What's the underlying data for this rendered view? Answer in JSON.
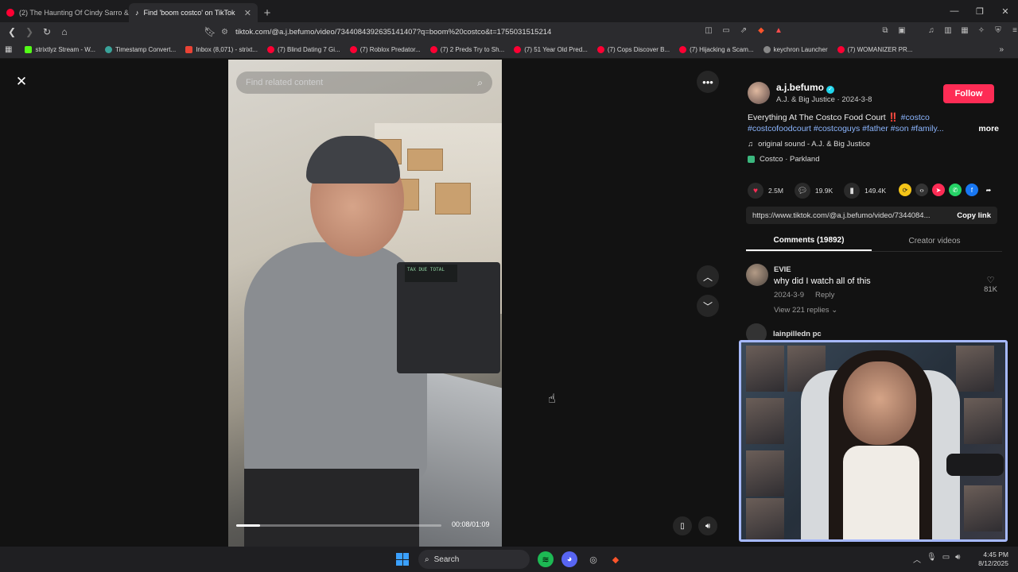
{
  "browser": {
    "tabs": [
      {
        "title": "(2) The Haunting Of Cindy Sarro & Th",
        "favicon_color": "#ff0033"
      },
      {
        "title": "Find 'boom costco' on TikTok",
        "favicon_color": "#111111"
      }
    ],
    "new_tab_label": "+",
    "url": "tiktok.com/@a.j.befumo/video/7344084392635141407?q=boom%20costco&t=1755031515214",
    "bookmarks": [
      {
        "label": "strixtlyz Stream - W...",
        "color": "#53fc18"
      },
      {
        "label": "Timestamp Convert...",
        "color": "#3aa39a"
      },
      {
        "label": "Inbox (8,071) - strixt...",
        "color": "#ea4335"
      },
      {
        "label": "(7) Blind Dating 7 Gi...",
        "color": "#ff0033"
      },
      {
        "label": "(7) Roblox Predator...",
        "color": "#ff0033"
      },
      {
        "label": "(7) 2 Preds Try to Sh...",
        "color": "#ff0033"
      },
      {
        "label": "(7) 51 Year Old Pred...",
        "color": "#ff0033"
      },
      {
        "label": "(7) Cops Discover B...",
        "color": "#ff0033"
      },
      {
        "label": "(7) Hijacking a Scam...",
        "color": "#ff0033"
      },
      {
        "label": "keychron Launcher",
        "color": "#888888"
      },
      {
        "label": "(7) WOMANIZER PR...",
        "color": "#ff0033"
      }
    ]
  },
  "player": {
    "search_placeholder": "Find related content",
    "timecode": "00:08/01:09",
    "progress_fraction": 0.116,
    "register_text": "TAX DUE TOTAL"
  },
  "sidebar": {
    "username": "a.j.befumo",
    "subtitle": "A.J. & Big Justice · 2024-3-8",
    "follow_label": "Follow",
    "description": "Everything At The Costco Food Court ‼️",
    "tags_line1": "#costco",
    "tags_line2": "#costcofoodcourt #costcoguys #father #son #family...",
    "more_label": "more",
    "sound": "original sound - A.J. & Big Justice",
    "location": "Costco · Parkland",
    "likes": "2.5M",
    "comments_count": "19.9K",
    "saves": "149.4K",
    "link": "https://www.tiktok.com/@a.j.befumo/video/7344084...",
    "copy_label": "Copy link",
    "tab_comments": "Comments (19892)",
    "tab_creator": "Creator videos",
    "comment1": {
      "name": "EVIE",
      "text": "why did I watch all of this",
      "date": "2024-3-9",
      "reply": "Reply",
      "view_replies": "View 221 replies",
      "likes": "81K"
    },
    "comment2": {
      "name": "lainpilledn pc"
    }
  },
  "taskbar": {
    "search_label": "Search",
    "time": "4:45 PM",
    "date": "8/12/2025"
  },
  "colors": {
    "accent": "#fe2c55",
    "tag": "#8cb6ff",
    "cam_border": "#a6b9ff"
  }
}
